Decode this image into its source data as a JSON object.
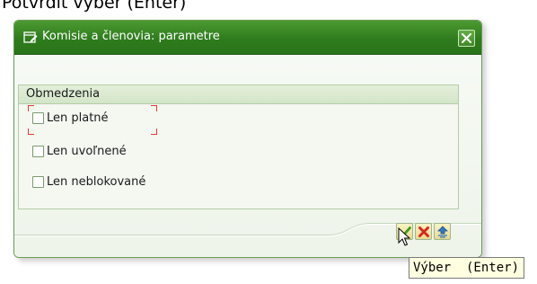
{
  "page": {
    "heading": "Potvrdiť výber (Enter)"
  },
  "dialog": {
    "title": "Komisie a členovia: parametre",
    "close_icon": "close-icon",
    "title_icon": "edit-window-icon"
  },
  "group": {
    "title": "Obmedzenia",
    "options": [
      {
        "label": "Len platné",
        "checked": false,
        "focused": true
      },
      {
        "label": "Len uvoľnené",
        "checked": false,
        "focused": false
      },
      {
        "label": "Len neblokované",
        "checked": false,
        "focused": false
      }
    ]
  },
  "buttons": {
    "confirm_icon": "checkmark-icon",
    "cancel_icon": "cancel-x-icon",
    "variant_icon": "multiple-selection-icon"
  },
  "tooltip": {
    "text": "Výber  (Enter)"
  },
  "colors": {
    "title_bar": "#2e7c1d",
    "focus_marker": "#e53c2f",
    "tooltip_bg": "#ffffe1"
  }
}
